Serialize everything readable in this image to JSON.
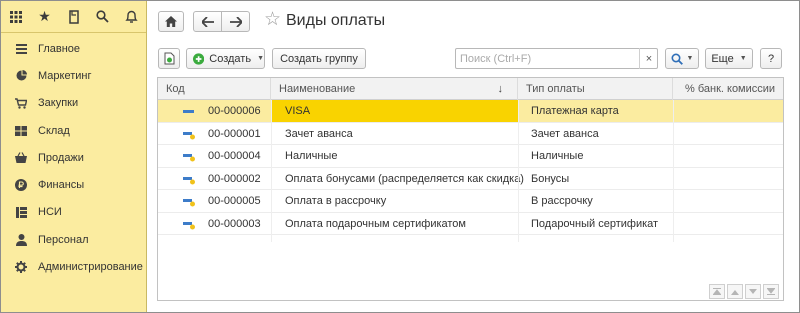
{
  "sidebar": {
    "top_icons": [
      "apps-grid-icon",
      "star-icon",
      "history-icon",
      "search-icon",
      "bell-icon"
    ],
    "items": [
      {
        "label": "Главное",
        "icon": "menu-icon"
      },
      {
        "label": "Маркетинг",
        "icon": "pie-chart-icon"
      },
      {
        "label": "Закупки",
        "icon": "cart-icon"
      },
      {
        "label": "Склад",
        "icon": "warehouse-icon"
      },
      {
        "label": "Продажи",
        "icon": "basket-icon"
      },
      {
        "label": "Финансы",
        "icon": "ruble-icon"
      },
      {
        "label": "НСИ",
        "icon": "catalog-icon"
      },
      {
        "label": "Персонал",
        "icon": "person-icon"
      },
      {
        "label": "Администрирование",
        "icon": "gear-icon"
      }
    ]
  },
  "header": {
    "title": "Виды оплаты"
  },
  "toolbar": {
    "create_label": "Создать",
    "create_group_label": "Создать группу",
    "search_placeholder": "Поиск (Ctrl+F)",
    "search_clear": "×",
    "more_label": "Еще",
    "help_label": "?"
  },
  "table": {
    "columns": [
      "Код",
      "Наименование",
      "Тип оплаты",
      "% банк. комиссии"
    ],
    "sort_indicator": "↓",
    "rows": [
      {
        "code": "00-000006",
        "name": "VISA",
        "type": "Платежная карта",
        "commission": "",
        "selected": true
      },
      {
        "code": "00-000001",
        "name": "Зачет аванса",
        "type": "Зачет аванса",
        "commission": "",
        "selected": false
      },
      {
        "code": "00-000004",
        "name": "Наличные",
        "type": "Наличные",
        "commission": "",
        "selected": false
      },
      {
        "code": "00-000002",
        "name": "Оплата бонусами (распределяется как скидка)",
        "type": "Бонусы",
        "commission": "",
        "selected": false
      },
      {
        "code": "00-000005",
        "name": "Оплата в рассрочку",
        "type": "В рассрочку",
        "commission": "",
        "selected": false
      },
      {
        "code": "00-000003",
        "name": "Оплата подарочным сертификатом",
        "type": "Подарочный сертификат",
        "commission": "",
        "selected": false
      }
    ]
  },
  "colors": {
    "sidebar_bg": "#fbeca0",
    "selected_row": "#fbeca0",
    "selected_cell": "#f9d300",
    "create_icon": "#3bab3e"
  }
}
